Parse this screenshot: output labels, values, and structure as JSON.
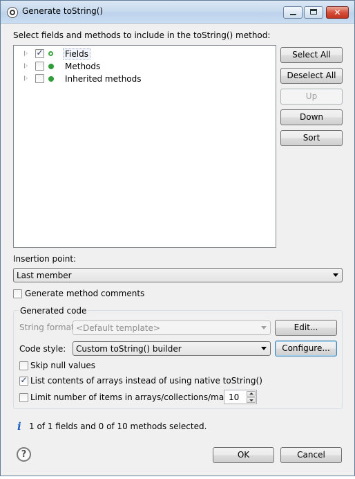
{
  "window": {
    "title": "Generate toString()",
    "buttons": [
      "minimize-icon",
      "maximize-icon",
      "close-icon"
    ]
  },
  "select_label": "Select fields and methods to include in the toString() method:",
  "tree": [
    {
      "label": "Fields",
      "checked": true,
      "icon": "field-open-icon"
    },
    {
      "label": "Methods",
      "checked": false,
      "icon": "method-icon"
    },
    {
      "label": "Inherited methods",
      "checked": false,
      "icon": "method-icon"
    }
  ],
  "side_buttons": {
    "select_all": "Select All",
    "deselect_all": "Deselect All",
    "up": "Up",
    "down": "Down",
    "sort": "Sort"
  },
  "insertion": {
    "label": "Insertion point:",
    "value": "Last member"
  },
  "generate_comments": {
    "label": "Generate method comments",
    "checked": false
  },
  "generated_code": {
    "title": "Generated code",
    "string_format": {
      "label": "String format:",
      "value": "<Default template>",
      "button": "Edit..."
    },
    "code_style": {
      "label": "Code style:",
      "value": "Custom toString() builder",
      "button": "Configure..."
    },
    "skip_null": {
      "label": "Skip null values",
      "checked": false
    },
    "list_arrays": {
      "label": "List contents of arrays instead of using native toString()",
      "checked": true
    },
    "limit_items": {
      "label": "Limit number of items in arrays/collections/maps to",
      "checked": false,
      "value": "10"
    }
  },
  "status": {
    "icon": "info-icon",
    "text": "1 of 1 fields and 0 of 10 methods selected."
  },
  "footer": {
    "help_icon": "?",
    "ok": "OK",
    "cancel": "Cancel"
  }
}
